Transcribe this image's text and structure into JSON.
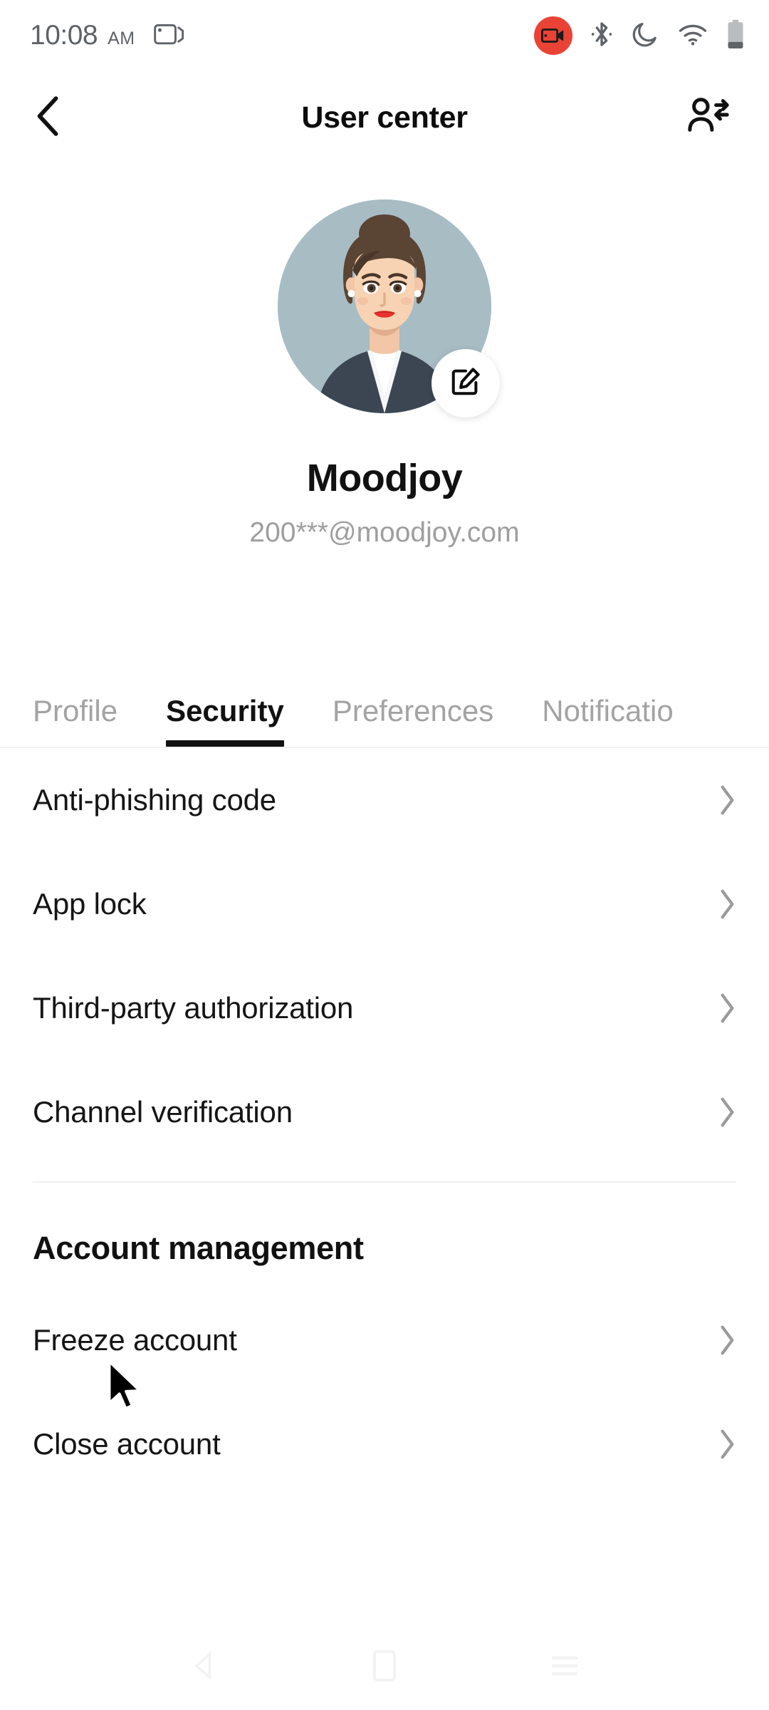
{
  "status_bar": {
    "time": "10:08",
    "ampm": "AM",
    "icons": [
      "cast-screen-icon",
      "screen-record-icon",
      "bluetooth-icon",
      "do-not-disturb-icon",
      "wifi-icon",
      "battery-icon"
    ],
    "recording_color": "#ea4335"
  },
  "app_bar": {
    "back_icon": "chevron-left-icon",
    "title": "User center",
    "action_icon": "switch-account-icon"
  },
  "profile": {
    "avatar_alt": "woman-avatar-illustration",
    "avatar_bg": "#a8bcc4",
    "edit_icon": "edit-pencil-icon",
    "name": "Moodjoy",
    "email": "200***@moodjoy.com"
  },
  "tabs": {
    "active_index": 1,
    "items": [
      {
        "label": "Profile"
      },
      {
        "label": "Security"
      },
      {
        "label": "Preferences"
      },
      {
        "label": "Notificatio"
      }
    ]
  },
  "security_list": {
    "items": [
      {
        "label": "Anti-phishing code",
        "chevron": "chevron-right-icon"
      },
      {
        "label": "App lock",
        "chevron": "chevron-right-icon"
      },
      {
        "label": "Third-party authorization",
        "chevron": "chevron-right-icon"
      },
      {
        "label": "Channel verification",
        "chevron": "chevron-right-icon"
      }
    ]
  },
  "account_management": {
    "title": "Account management",
    "items": [
      {
        "label": "Freeze account",
        "chevron": "chevron-right-icon"
      },
      {
        "label": "Close account",
        "chevron": "chevron-right-icon"
      }
    ]
  },
  "nav_bar": {
    "items": [
      "back-nav-icon",
      "home-nav-icon",
      "recents-nav-icon"
    ]
  },
  "colors": {
    "text_primary": "#111111",
    "text_muted": "#9e9e9e",
    "accent": "#111111",
    "divider": "#f0f0f0"
  }
}
